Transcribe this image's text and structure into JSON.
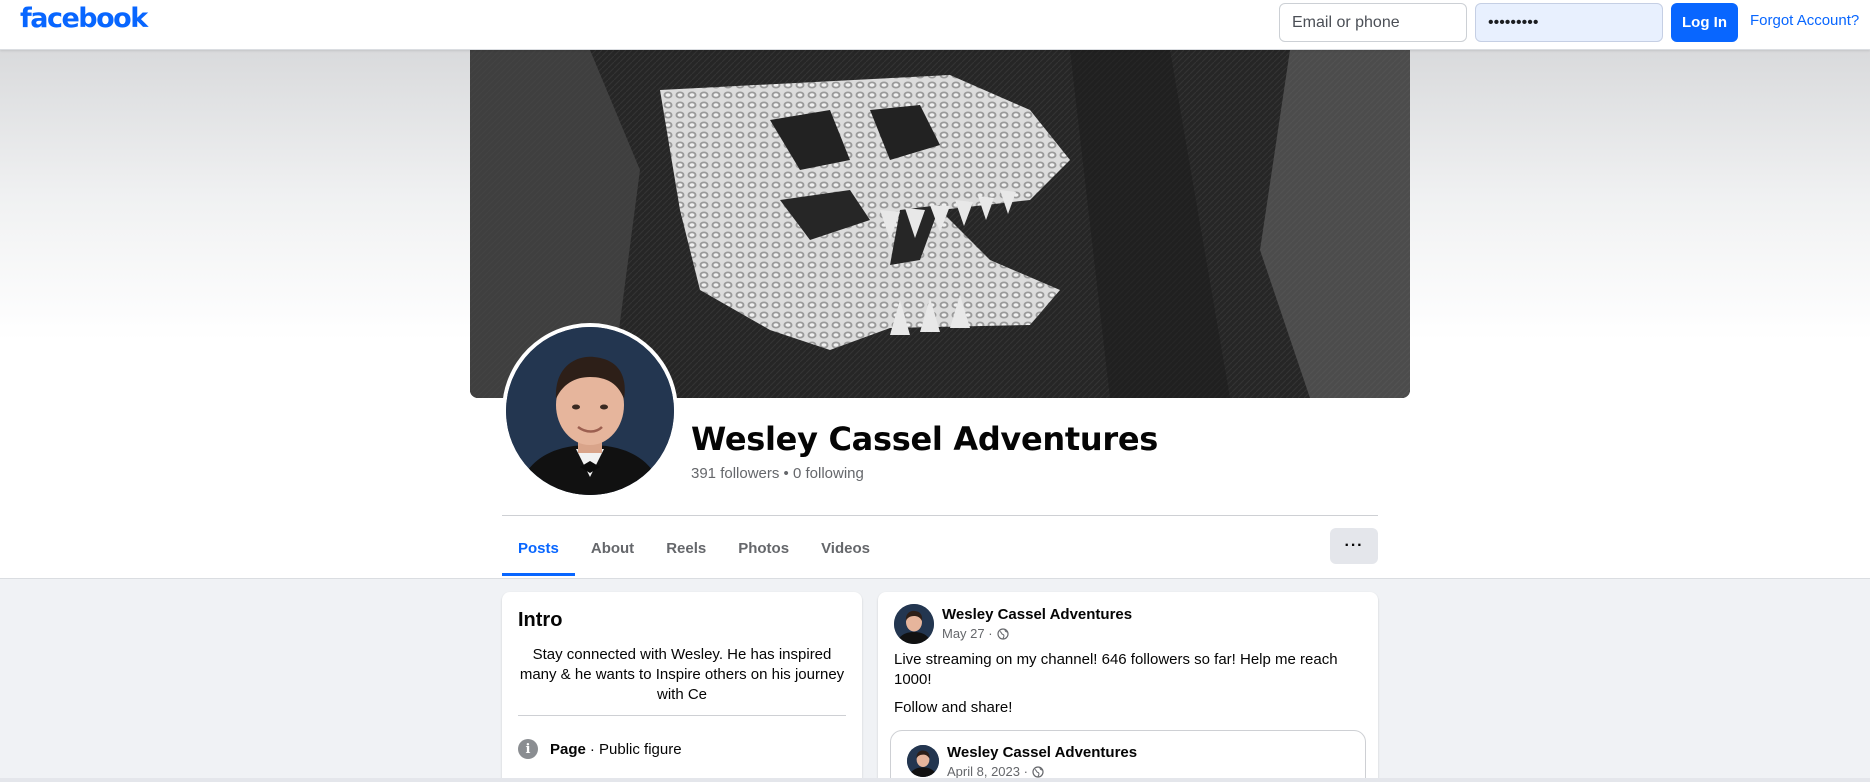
{
  "topbar": {
    "logo": "facebook",
    "email_placeholder": "Email or phone",
    "password_value": "•••••••••",
    "login_label": "Log In",
    "forgot_label": "Forgot Account?"
  },
  "profile": {
    "name": "Wesley Cassel Adventures",
    "stats": "391 followers • 0 following"
  },
  "tabs": [
    {
      "label": "Posts",
      "active": true
    },
    {
      "label": "About",
      "active": false
    },
    {
      "label": "Reels",
      "active": false
    },
    {
      "label": "Photos",
      "active": false
    },
    {
      "label": "Videos",
      "active": false
    }
  ],
  "more_label": "···",
  "intro": {
    "title": "Intro",
    "bio": "Stay connected with Wesley. He has inspired many & he wants to Inspire others on his journey with Ce",
    "category_label": "Page",
    "category_value": "· Public figure",
    "info_icon_glyph": "i"
  },
  "post": {
    "author": "Wesley Cassel Adventures",
    "date": "May 27 ·",
    "text_1": "Live streaming on my channel!  646 followers so far! Help me reach 1000!",
    "text_2": "Follow and share!",
    "shared": {
      "author": "Wesley Cassel Adventures",
      "date": "April 8, 2023 ·"
    }
  },
  "colors": {
    "brand": "#0866ff",
    "page_bg": "#f0f2f5",
    "secondary_text": "#65676b"
  },
  "icons": [
    "globe-icon",
    "info-icon",
    "more-options-icon"
  ]
}
